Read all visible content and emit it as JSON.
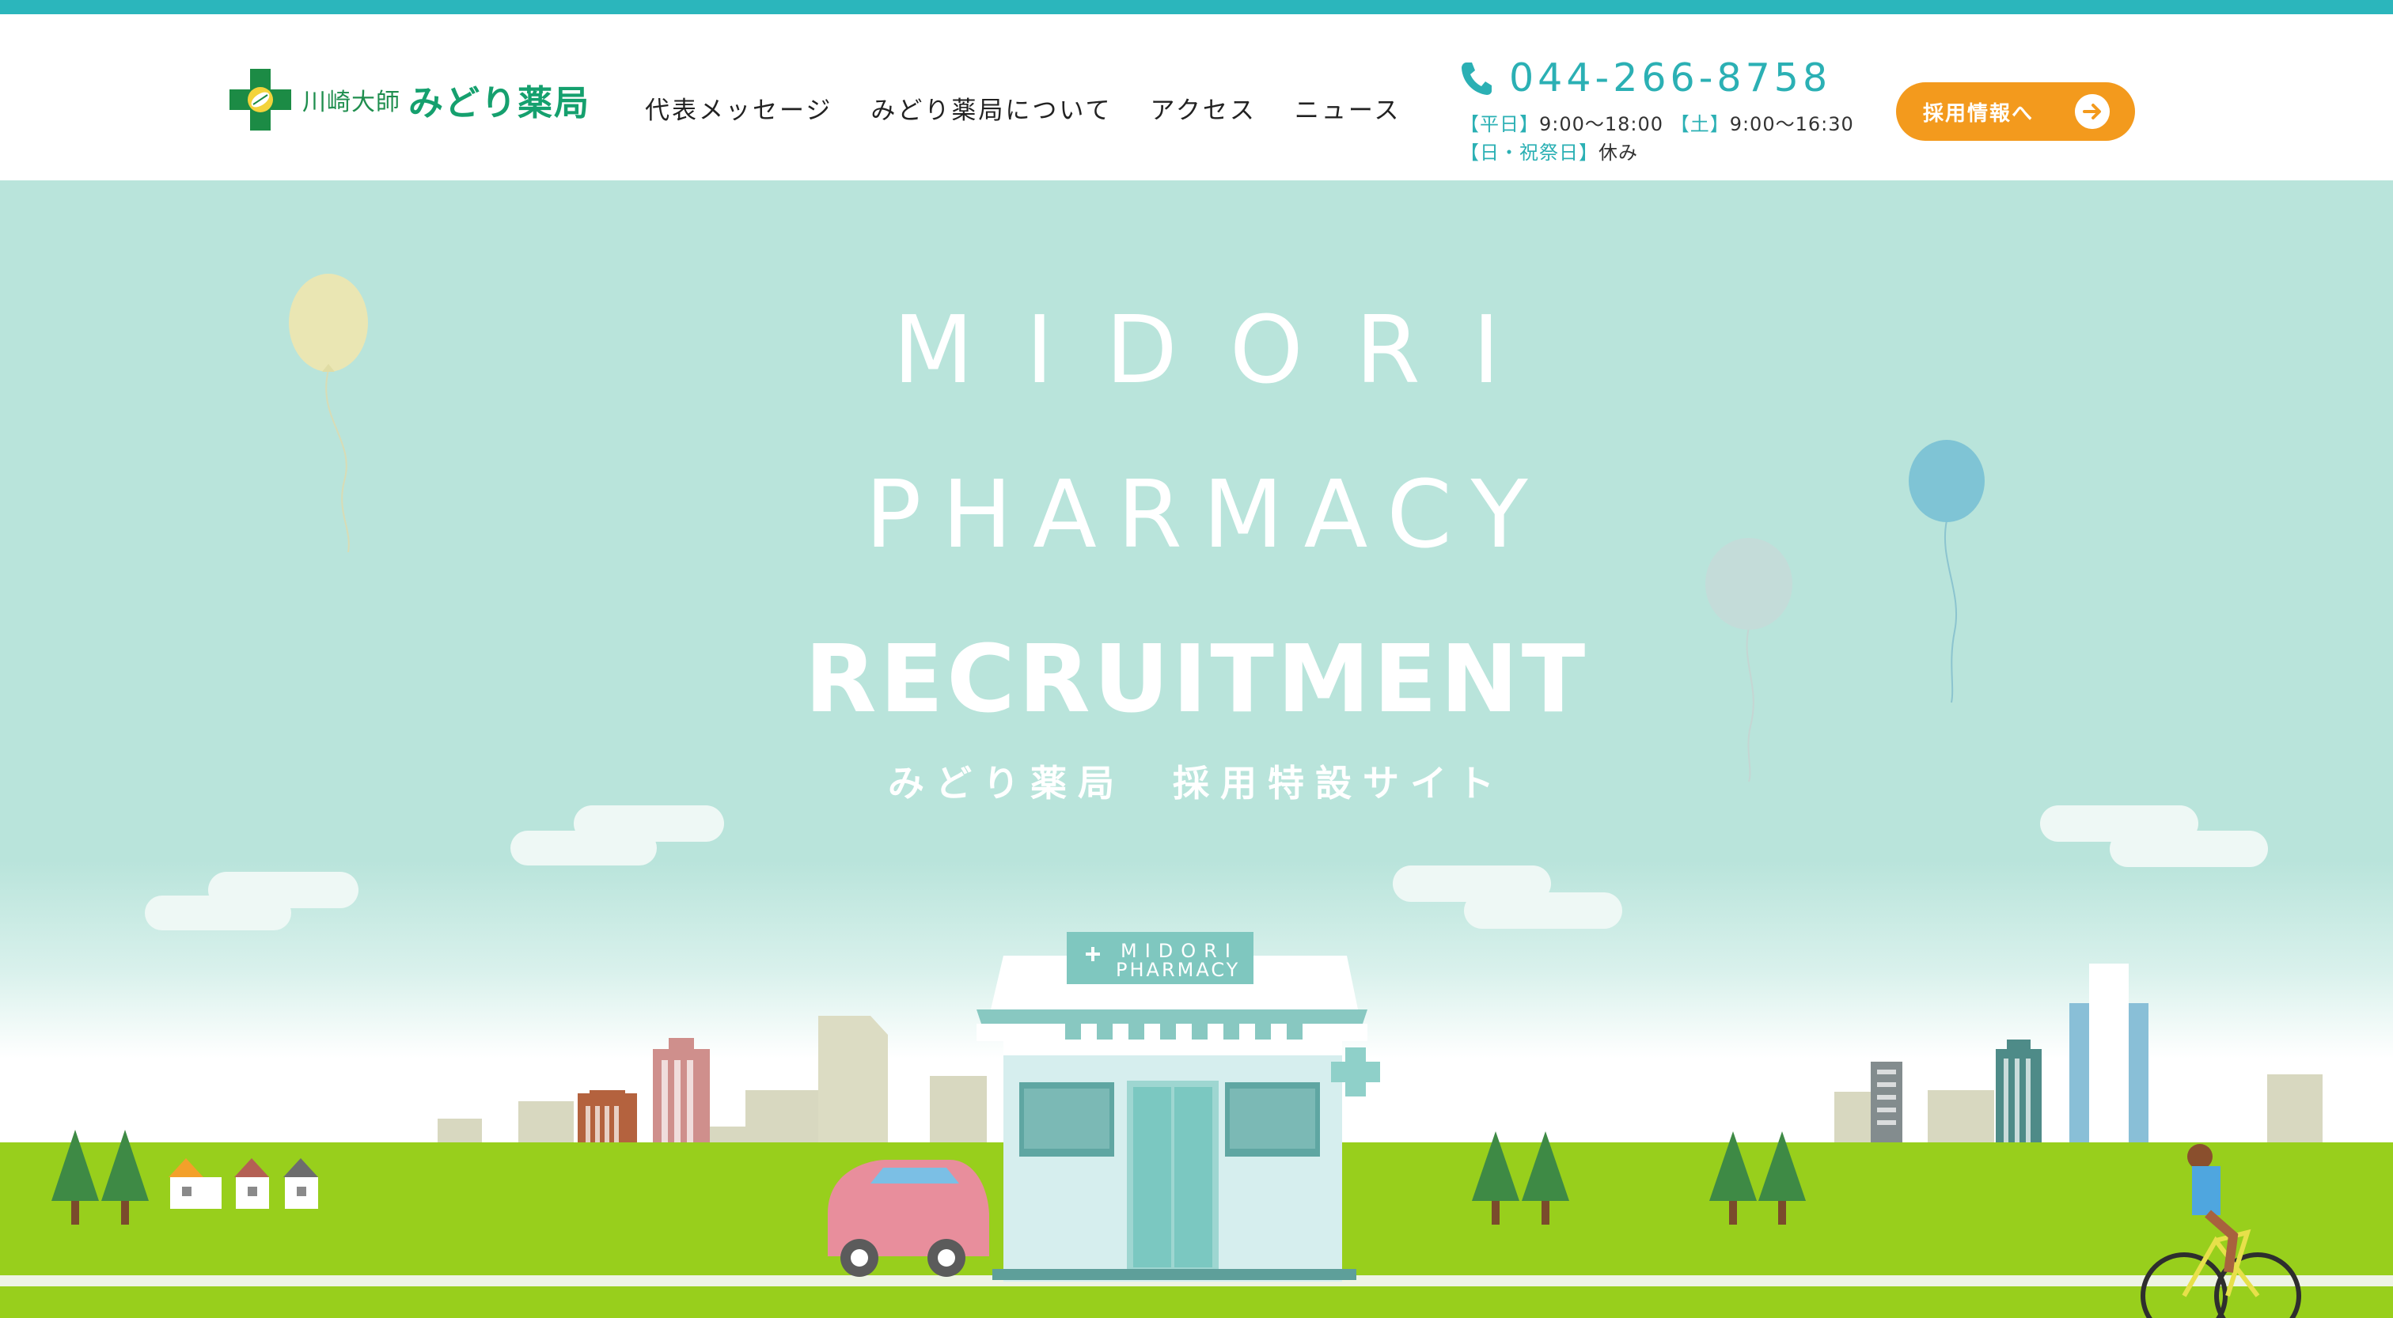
{
  "brand": {
    "logo_sub": "川崎大師",
    "logo_main": "みどり薬局"
  },
  "nav": {
    "items": [
      {
        "label": "代表メッセージ"
      },
      {
        "label": "みどり薬局について"
      },
      {
        "label": "アクセス"
      },
      {
        "label": "ニュース"
      }
    ]
  },
  "contact": {
    "phone": "044-266-8758",
    "weekday_tag": "【平日】",
    "weekday_hours": "9:00〜18:00",
    "saturday_tag": "【土】",
    "saturday_hours": "9:00〜16:30",
    "closed_tag": "【日・祝祭日】",
    "closed_text": "休み"
  },
  "recruit_button": {
    "label": "採用情報へ"
  },
  "hero": {
    "title_line1": "MIDORI",
    "title_line2": "PHARMACY",
    "title_line3": "RECRUITMENT",
    "subtitle": "みどり薬局　採用特設サイト",
    "sign_line1": "MIDORI",
    "sign_line2": "PHARMACY"
  },
  "colors": {
    "accent_teal": "#2bb6bc",
    "brand_green": "#15a06e",
    "button_orange": "#f39a1d",
    "sky": "#b9e4db",
    "grass": "#98cf1c"
  },
  "icons": [
    "logo-cross-icon",
    "phone-icon",
    "arrow-right-icon"
  ]
}
